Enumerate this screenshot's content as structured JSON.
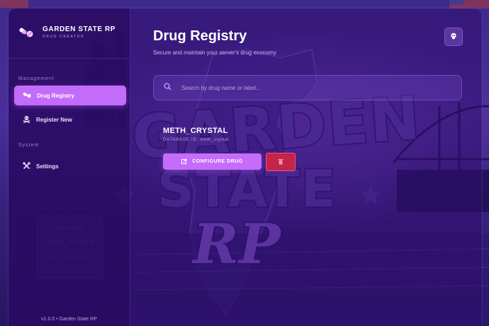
{
  "brand": {
    "title": "GARDEN STATE RP",
    "subtitle": "DRUG CREATOR",
    "logo_icon": "pills-icon"
  },
  "sidebar": {
    "sections": [
      {
        "label": "Management",
        "items": [
          {
            "label": "Drug Registry",
            "icon": "pills-icon",
            "active": true
          },
          {
            "label": "Register New",
            "icon": "skull-crossbones-icon",
            "active": false
          }
        ]
      },
      {
        "label": "System",
        "items": [
          {
            "label": "Settings",
            "icon": "tools-icon",
            "active": false
          }
        ]
      }
    ],
    "version": "v1.0.0 • Garden State RP"
  },
  "main": {
    "title": "Drug Registry",
    "subtitle": "Secure and maintain your server's drug economy",
    "corner_icon": "skull-icon",
    "search": {
      "placeholder": "Search by drug name or label..."
    },
    "drug_card": {
      "name": "METH_CRYSTAL",
      "meta_label": "DATABASE ID:",
      "meta_value": "meth_crystal",
      "configure_label": "CONFIGURE DRUG",
      "configure_icon": "edit-icon",
      "delete_icon": "trash-icon"
    }
  },
  "colors": {
    "accent": "#c56cfb",
    "danger": "#c2244a",
    "panel": "#28105f",
    "background": "#3d2a8a"
  }
}
